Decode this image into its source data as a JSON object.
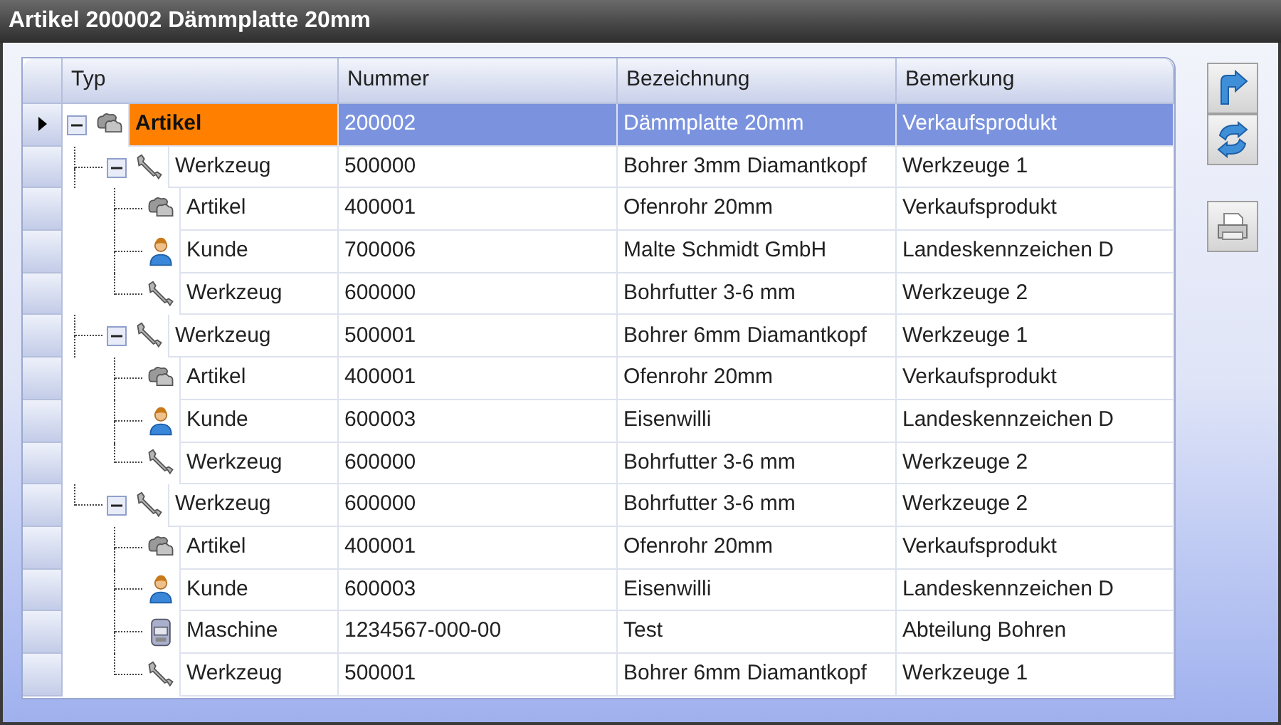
{
  "window": {
    "title": "Artikel 200002 Dämmplatte 20mm"
  },
  "table": {
    "columns": [
      "Typ",
      "Nummer",
      "Bezeichnung",
      "Bemerkung"
    ],
    "rows": [
      {
        "kind": "artikel",
        "typ": "Artikel",
        "nummer": "200002",
        "bezeichnung": "Dämmplatte 20mm",
        "bemerkung": "Verkaufsprodukt",
        "selected": true,
        "expanded": true,
        "children": [
          {
            "kind": "werkzeug",
            "typ": "Werkzeug",
            "nummer": "500000",
            "bezeichnung": "Bohrer 3mm Diamantkopf",
            "bemerkung": "Werkzeuge 1",
            "selected": false,
            "expanded": true,
            "children": [
              {
                "kind": "artikel",
                "typ": "Artikel",
                "nummer": "400001",
                "bezeichnung": "Ofenrohr 20mm",
                "bemerkung": "Verkaufsprodukt",
                "selected": false
              },
              {
                "kind": "kunde",
                "typ": "Kunde",
                "nummer": "700006",
                "bezeichnung": "Malte Schmidt GmbH",
                "bemerkung": "Landeskennzeichen D",
                "selected": false
              },
              {
                "kind": "werkzeug",
                "typ": "Werkzeug",
                "nummer": "600000",
                "bezeichnung": "Bohrfutter 3-6 mm",
                "bemerkung": "Werkzeuge 2",
                "selected": false
              }
            ]
          },
          {
            "kind": "werkzeug",
            "typ": "Werkzeug",
            "nummer": "500001",
            "bezeichnung": "Bohrer 6mm Diamantkopf",
            "bemerkung": "Werkzeuge 1",
            "selected": false,
            "expanded": true,
            "children": [
              {
                "kind": "artikel",
                "typ": "Artikel",
                "nummer": "400001",
                "bezeichnung": "Ofenrohr 20mm",
                "bemerkung": "Verkaufsprodukt",
                "selected": false
              },
              {
                "kind": "kunde",
                "typ": "Kunde",
                "nummer": "600003",
                "bezeichnung": "Eisenwilli",
                "bemerkung": "Landeskennzeichen D",
                "selected": false
              },
              {
                "kind": "werkzeug",
                "typ": "Werkzeug",
                "nummer": "600000",
                "bezeichnung": "Bohrfutter 3-6 mm",
                "bemerkung": "Werkzeuge 2",
                "selected": false
              }
            ]
          },
          {
            "kind": "werkzeug",
            "typ": "Werkzeug",
            "nummer": "600000",
            "bezeichnung": "Bohrfutter 3-6 mm",
            "bemerkung": "Werkzeuge 2",
            "selected": false,
            "expanded": true,
            "children": [
              {
                "kind": "artikel",
                "typ": "Artikel",
                "nummer": "400001",
                "bezeichnung": "Ofenrohr 20mm",
                "bemerkung": "Verkaufsprodukt",
                "selected": false
              },
              {
                "kind": "kunde",
                "typ": "Kunde",
                "nummer": "600003",
                "bezeichnung": "Eisenwilli",
                "bemerkung": "Landeskennzeichen D",
                "selected": false
              },
              {
                "kind": "maschine",
                "typ": "Maschine",
                "nummer": "1234567-000-00",
                "bezeichnung": "Test",
                "bemerkung": "Abteilung Bohren",
                "selected": false
              },
              {
                "kind": "werkzeug",
                "typ": "Werkzeug",
                "nummer": "500001",
                "bezeichnung": "Bohrer 6mm Diamantkopf",
                "bemerkung": "Werkzeuge 1",
                "selected": false
              }
            ]
          }
        ]
      }
    ]
  }
}
